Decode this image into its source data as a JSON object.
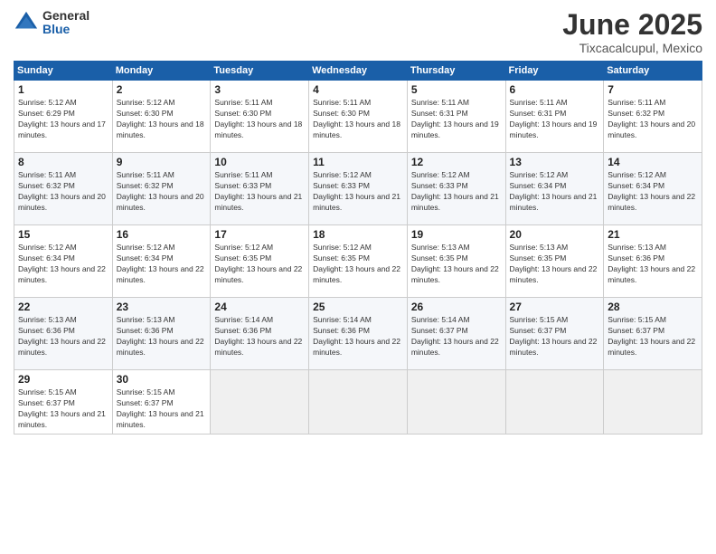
{
  "logo": {
    "general": "General",
    "blue": "Blue"
  },
  "header": {
    "month_year": "June 2025",
    "location": "Tixcacalcupul, Mexico"
  },
  "weekdays": [
    "Sunday",
    "Monday",
    "Tuesday",
    "Wednesday",
    "Thursday",
    "Friday",
    "Saturday"
  ],
  "weeks": [
    [
      {
        "day": "1",
        "sunrise": "5:12 AM",
        "sunset": "6:29 PM",
        "daylight": "13 hours and 17 minutes."
      },
      {
        "day": "2",
        "sunrise": "5:12 AM",
        "sunset": "6:30 PM",
        "daylight": "13 hours and 18 minutes."
      },
      {
        "day": "3",
        "sunrise": "5:11 AM",
        "sunset": "6:30 PM",
        "daylight": "13 hours and 18 minutes."
      },
      {
        "day": "4",
        "sunrise": "5:11 AM",
        "sunset": "6:30 PM",
        "daylight": "13 hours and 18 minutes."
      },
      {
        "day": "5",
        "sunrise": "5:11 AM",
        "sunset": "6:31 PM",
        "daylight": "13 hours and 19 minutes."
      },
      {
        "day": "6",
        "sunrise": "5:11 AM",
        "sunset": "6:31 PM",
        "daylight": "13 hours and 19 minutes."
      },
      {
        "day": "7",
        "sunrise": "5:11 AM",
        "sunset": "6:32 PM",
        "daylight": "13 hours and 20 minutes."
      }
    ],
    [
      {
        "day": "8",
        "sunrise": "5:11 AM",
        "sunset": "6:32 PM",
        "daylight": "13 hours and 20 minutes."
      },
      {
        "day": "9",
        "sunrise": "5:11 AM",
        "sunset": "6:32 PM",
        "daylight": "13 hours and 20 minutes."
      },
      {
        "day": "10",
        "sunrise": "5:11 AM",
        "sunset": "6:33 PM",
        "daylight": "13 hours and 21 minutes."
      },
      {
        "day": "11",
        "sunrise": "5:12 AM",
        "sunset": "6:33 PM",
        "daylight": "13 hours and 21 minutes."
      },
      {
        "day": "12",
        "sunrise": "5:12 AM",
        "sunset": "6:33 PM",
        "daylight": "13 hours and 21 minutes."
      },
      {
        "day": "13",
        "sunrise": "5:12 AM",
        "sunset": "6:34 PM",
        "daylight": "13 hours and 21 minutes."
      },
      {
        "day": "14",
        "sunrise": "5:12 AM",
        "sunset": "6:34 PM",
        "daylight": "13 hours and 22 minutes."
      }
    ],
    [
      {
        "day": "15",
        "sunrise": "5:12 AM",
        "sunset": "6:34 PM",
        "daylight": "13 hours and 22 minutes."
      },
      {
        "day": "16",
        "sunrise": "5:12 AM",
        "sunset": "6:34 PM",
        "daylight": "13 hours and 22 minutes."
      },
      {
        "day": "17",
        "sunrise": "5:12 AM",
        "sunset": "6:35 PM",
        "daylight": "13 hours and 22 minutes."
      },
      {
        "day": "18",
        "sunrise": "5:12 AM",
        "sunset": "6:35 PM",
        "daylight": "13 hours and 22 minutes."
      },
      {
        "day": "19",
        "sunrise": "5:13 AM",
        "sunset": "6:35 PM",
        "daylight": "13 hours and 22 minutes."
      },
      {
        "day": "20",
        "sunrise": "5:13 AM",
        "sunset": "6:35 PM",
        "daylight": "13 hours and 22 minutes."
      },
      {
        "day": "21",
        "sunrise": "5:13 AM",
        "sunset": "6:36 PM",
        "daylight": "13 hours and 22 minutes."
      }
    ],
    [
      {
        "day": "22",
        "sunrise": "5:13 AM",
        "sunset": "6:36 PM",
        "daylight": "13 hours and 22 minutes."
      },
      {
        "day": "23",
        "sunrise": "5:13 AM",
        "sunset": "6:36 PM",
        "daylight": "13 hours and 22 minutes."
      },
      {
        "day": "24",
        "sunrise": "5:14 AM",
        "sunset": "6:36 PM",
        "daylight": "13 hours and 22 minutes."
      },
      {
        "day": "25",
        "sunrise": "5:14 AM",
        "sunset": "6:36 PM",
        "daylight": "13 hours and 22 minutes."
      },
      {
        "day": "26",
        "sunrise": "5:14 AM",
        "sunset": "6:37 PM",
        "daylight": "13 hours and 22 minutes."
      },
      {
        "day": "27",
        "sunrise": "5:15 AM",
        "sunset": "6:37 PM",
        "daylight": "13 hours and 22 minutes."
      },
      {
        "day": "28",
        "sunrise": "5:15 AM",
        "sunset": "6:37 PM",
        "daylight": "13 hours and 22 minutes."
      }
    ],
    [
      {
        "day": "29",
        "sunrise": "5:15 AM",
        "sunset": "6:37 PM",
        "daylight": "13 hours and 21 minutes."
      },
      {
        "day": "30",
        "sunrise": "5:15 AM",
        "sunset": "6:37 PM",
        "daylight": "13 hours and 21 minutes."
      },
      null,
      null,
      null,
      null,
      null
    ]
  ]
}
